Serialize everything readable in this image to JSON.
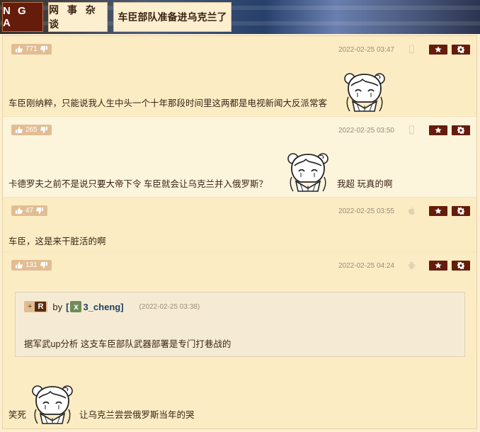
{
  "header": {
    "logo": "N G A",
    "breadcrumbs": [
      "网 事 杂 谈",
      "车臣部队准备进乌克兰了"
    ]
  },
  "colors": {
    "accent": "#651c0b",
    "page_bg": "#fcefd0",
    "like_pill": "#e2bd93",
    "timestamp": "#9a8b78",
    "username": "#1f3f5e"
  },
  "posts": [
    {
      "likes": "771",
      "time": "2022-02-25 03:47",
      "device_icon": "phone-icon",
      "text": "车臣刚纳粹，只能说我人生中头一个十年那段时间里这两都是电视新闻大反派常客",
      "sticker": "anime-girl-sticker"
    },
    {
      "likes": "265",
      "time": "2022-02-25 03:50",
      "device_icon": "phone-icon",
      "text_before": "卡德罗夫之前不是说只要大帝下令 车臣就会让乌克兰并入俄罗斯？",
      "sticker": "anime-girl-sticker",
      "text_after": "我超 玩真的啊"
    },
    {
      "likes": "47",
      "time": "2022-02-25 03:55",
      "device_icon": "apple-icon",
      "text": "车臣，这是来干脏活的啊"
    },
    {
      "likes": "131",
      "time": "2022-02-25 04:24",
      "device_icon": "android-icon",
      "quote": {
        "plus": "+",
        "badge": "R",
        "by": "by",
        "user": "[",
        "user_avatar": "x",
        "user_name": "3_cheng]",
        "time": "(2022-02-25 03:38)",
        "text": "据军武up分析 这支车臣部队武器部署是专门打巷战的"
      },
      "text_before": "笑死",
      "sticker": "anime-girl-sticker",
      "text_after": "让乌克兰尝尝俄罗斯当年的哭"
    }
  ]
}
